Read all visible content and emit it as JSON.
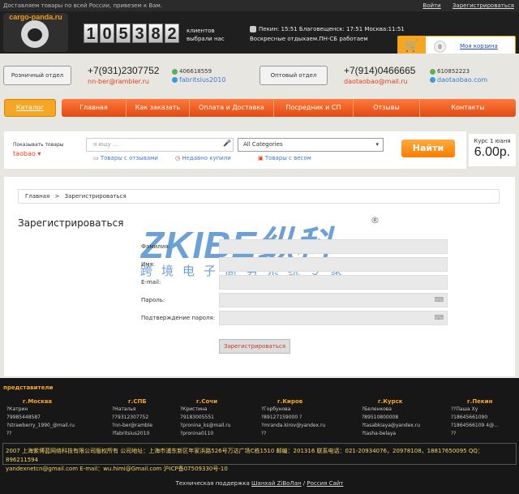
{
  "topbar": {
    "tagline": "Доставляем товары по всей России, привезем к Вам.",
    "login": "Войти",
    "register": "Зарегистрироваться"
  },
  "header": {
    "logo_text": "cargo-panda.ru",
    "counter_digits": [
      "1",
      "0",
      "5",
      "3",
      "8",
      "2"
    ],
    "clients_text": "клиентов выбрали нас",
    "times": "Пекин: 15:51  Благовещенск: 17:51  Москва:11:51",
    "schedule": "Воскресные отдыхаем.ПН-СБ работаем",
    "cart_count": "0",
    "cart_label": "Моя корзина"
  },
  "contacts": {
    "retail": {
      "label": "Розничный отдел",
      "phone": "+7(931)2307752",
      "email": "nn-ber@rambler.ru",
      "icq": "406618559",
      "skype": "fabritsius2010"
    },
    "wholesale": {
      "label": "Оптовый отдел",
      "phone": "+7(914)0466665",
      "email": "daotaobao@mail.ru",
      "icq": "610852223",
      "skype": "daotaobao.com"
    }
  },
  "nav": {
    "catalog": "Каталог",
    "items": [
      "Главная",
      "Как заказать",
      "Оплата и Доставка",
      "Посредник и СП",
      "Отзывы",
      "Контакты"
    ]
  },
  "search": {
    "show_label": "Показывать товары",
    "source": "taobao",
    "placeholder": "я ищу ...",
    "category": "All Categories",
    "link_reviews": "Товары с отзывами",
    "link_recent": "Недавно купили",
    "link_weight": "Товары с весом",
    "find_button": "Найти",
    "rate_label": "Курс 1 юаня",
    "rate_value": "6.00р."
  },
  "breadcrumb": {
    "home": "Главная",
    "sep": ">",
    "current": "Зарегистрироваться"
  },
  "page": {
    "title": "Зарегистрироваться",
    "watermark": "ZKIBE纵科",
    "watermark_sub": "跨境电子商务系统专家",
    "watermark_mark": "®"
  },
  "form": {
    "fields": [
      "Фамилия:",
      "Имя:",
      "E-mail:",
      "Пароль:",
      "Подтверждение пароля:"
    ],
    "submit": "Зарегистрироваться"
  },
  "footer": {
    "title": "представители",
    "columns": [
      {
        "city": "г.Москва",
        "name": "?Катрин",
        "phone": "79985448587",
        "email": "?strawberry_1990_@mail.ru",
        "skype": "??"
      },
      {
        "city": "г.СПБ",
        "name": "?Наталья",
        "phone": "?79312307752",
        "email": "?nn-ber@ramble",
        "skype": "?fabritsius2010"
      },
      {
        "city": "г.Сочи",
        "name": "?Кристина",
        "phone": "79183005551",
        "email": "?pronina_ks@mail.ru",
        "skype": "?pronina0110"
      },
      {
        "city": "г.Киров",
        "name": "?Горбунова",
        "phone": "?89127159000 ?",
        "email": "?mranda.kirov@yandex.ru",
        "skype": "??"
      },
      {
        "city": "г.Курск",
        "name": "?Беленкова",
        "phone": "?89510800008",
        "email": "?tasabkiaya@yandex.ru",
        "skype": "?tasha-belaya"
      },
      {
        "city": "г.Пекин",
        "name": "??Паша Ху",
        "phone": "?18645661090",
        "email": "?1864566109 4@...",
        "skype": "??"
      }
    ],
    "info_line1": "2007 上海紫博蓝网络科技有限公司版权所有 公司地址：上海市浦东新区年家浜路526号万达广场C栋1510 邮编：201316 联系电话：021-20934076，20978108，18817650095 QQ：896211594",
    "info_line2": "yandexnetcn@gmail.com E-mail：wu.himi@Gmail.com 沪ICP备07509330号-10",
    "support_prefix": "Техническая поддержка",
    "support_link1": "Шанхай ZiBoЛан",
    "support_sep": "/",
    "support_link2": "Россия Сайт"
  },
  "colors": {
    "accent": "#f5a623",
    "menu": "#e14a12",
    "link": "#3a7bd5",
    "email": "#e8401c"
  }
}
